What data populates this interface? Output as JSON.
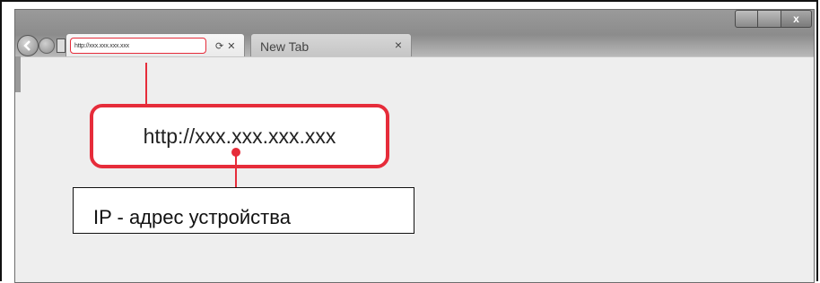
{
  "window": {
    "controls": {
      "minimize": "",
      "maximize": "",
      "close": "x"
    }
  },
  "tabs": [
    {
      "url": "http://xxx.xxx.xxx.xxx",
      "icons": [
        "gear-icon",
        "close-icon"
      ],
      "refresh_glyph": "⟳",
      "close_glyph": "✕"
    },
    {
      "label": "New Tab",
      "close_glyph": "×"
    }
  ],
  "callout": {
    "url": "http://xxx.xxx.xxx.xxx"
  },
  "annotation": {
    "label": "IP - адрес устройства"
  },
  "colors": {
    "accent": "#e62c3a",
    "chrome": "#9a9a9a",
    "content": "#eeeeee"
  }
}
